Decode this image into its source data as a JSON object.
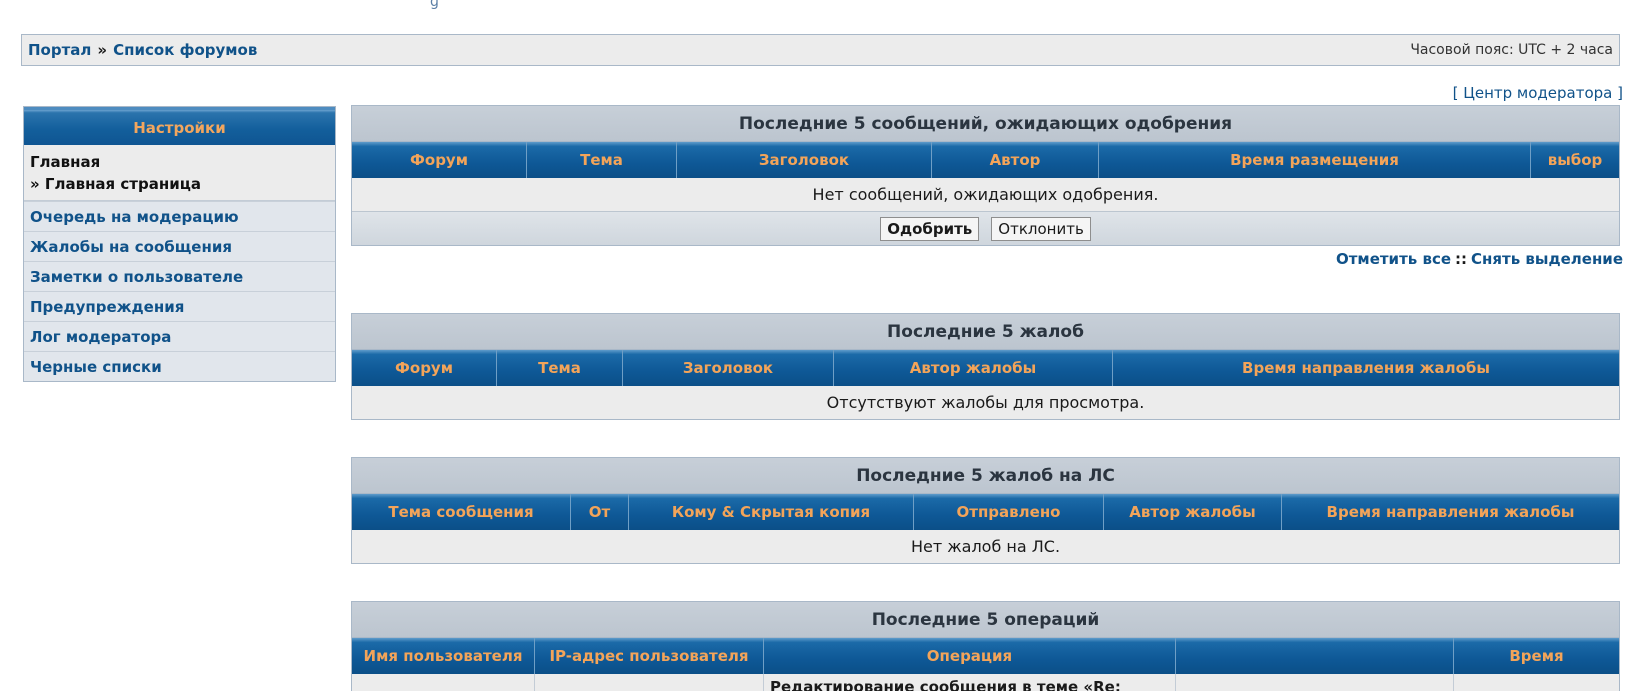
{
  "breadcrumb": {
    "items": [
      "Портал",
      "Список форумов"
    ],
    "separator": "»"
  },
  "timezone": "Часовой пояс: UTC + 2 часа",
  "mcp_link": "Центр модератора",
  "sidebar": {
    "header": "Настройки",
    "main_title": "Главная",
    "main_sub": "» Главная страница",
    "items": [
      "Очередь на модерацию",
      "Жалобы на сообщения",
      "Заметки о пользователе",
      "Предупреждения",
      "Лог модератора",
      "Черные списки"
    ]
  },
  "queue_panel": {
    "title": "Последние 5 сообщений, ожидающих одобрения",
    "columns": [
      "Форум",
      "Тема",
      "Заголовок",
      "Автор",
      "Время размещения",
      "выбор"
    ],
    "empty_text": "Нет сообщений, ожидающих одобрения.",
    "approve_label": "Одобрить",
    "reject_label": "Отклонить"
  },
  "mark_links": {
    "mark_all": "Отметить все",
    "separator": "::",
    "unmark_all": "Снять выделение"
  },
  "reports_panel": {
    "title": "Последние 5 жалоб",
    "columns": [
      "Форум",
      "Тема",
      "Заголовок",
      "Автор жалобы",
      "Время направления жалобы"
    ],
    "empty_text": "Отсутствуют жалобы для просмотра."
  },
  "pm_reports_panel": {
    "title": "Последние 5 жалоб на ЛС",
    "columns": [
      "Тема сообщения",
      "От",
      "Кому & Скрытая копия",
      "Отправлено",
      "Автор жалобы",
      "Время направления жалобы"
    ],
    "empty_text": "Нет жалоб на ЛС."
  },
  "logs_panel": {
    "title": "Последние 5 операций",
    "columns": [
      "Имя пользователя",
      "IP-адрес пользователя",
      "Операция",
      "",
      "Время"
    ],
    "first_row_operation": "Редактирование сообщения в теме «Re:"
  },
  "colors": {
    "link": "#105289",
    "header_text": "#f3a459",
    "header_bg": "#0e5896",
    "panel_bg": "#ececec",
    "title_bg": "#c3cbd4"
  }
}
